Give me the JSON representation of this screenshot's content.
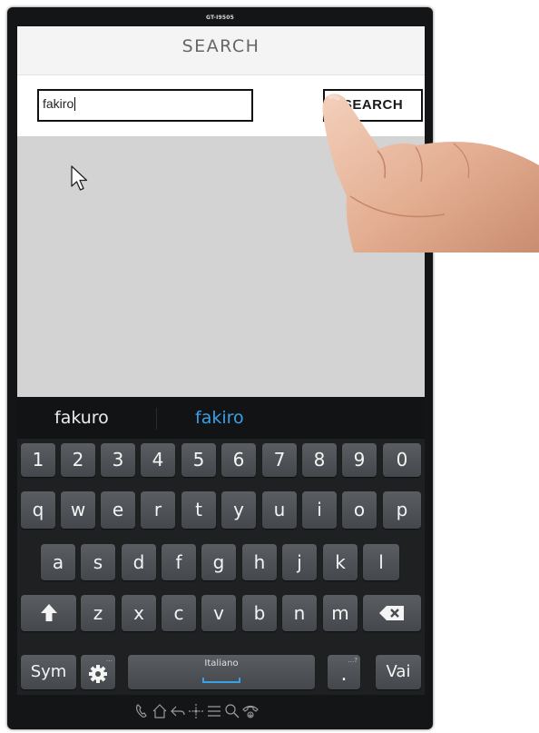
{
  "device": {
    "model": "GT-I9505"
  },
  "titlebar": {
    "title": "SEARCH"
  },
  "search": {
    "value": "fakiro",
    "button_label": "SEARCH"
  },
  "suggestions": [
    "fakuro",
    "fakiro"
  ],
  "keyboard": {
    "row_numbers": [
      "1",
      "2",
      "3",
      "4",
      "5",
      "6",
      "7",
      "8",
      "9",
      "0"
    ],
    "row_q": [
      "q",
      "w",
      "e",
      "r",
      "t",
      "y",
      "u",
      "i",
      "o",
      "p"
    ],
    "row_a": [
      "a",
      "s",
      "d",
      "f",
      "g",
      "h",
      "j",
      "k",
      "l"
    ],
    "row_z": [
      "z",
      "x",
      "c",
      "v",
      "b",
      "n",
      "m"
    ],
    "sym_label": "Sym",
    "language_label": "Italiano",
    "period_label": ".",
    "period_hint": "…?",
    "settings_hint": "…",
    "enter_label": "Vai"
  },
  "nav": {
    "icons": [
      "phone-icon",
      "home-icon",
      "back-icon",
      "move-icon",
      "menu-icon",
      "search-icon",
      "hangup-icon"
    ]
  },
  "colors": {
    "accent": "#3aa1e6",
    "keyboard_bg": "#1f2021",
    "key": "#505357"
  }
}
